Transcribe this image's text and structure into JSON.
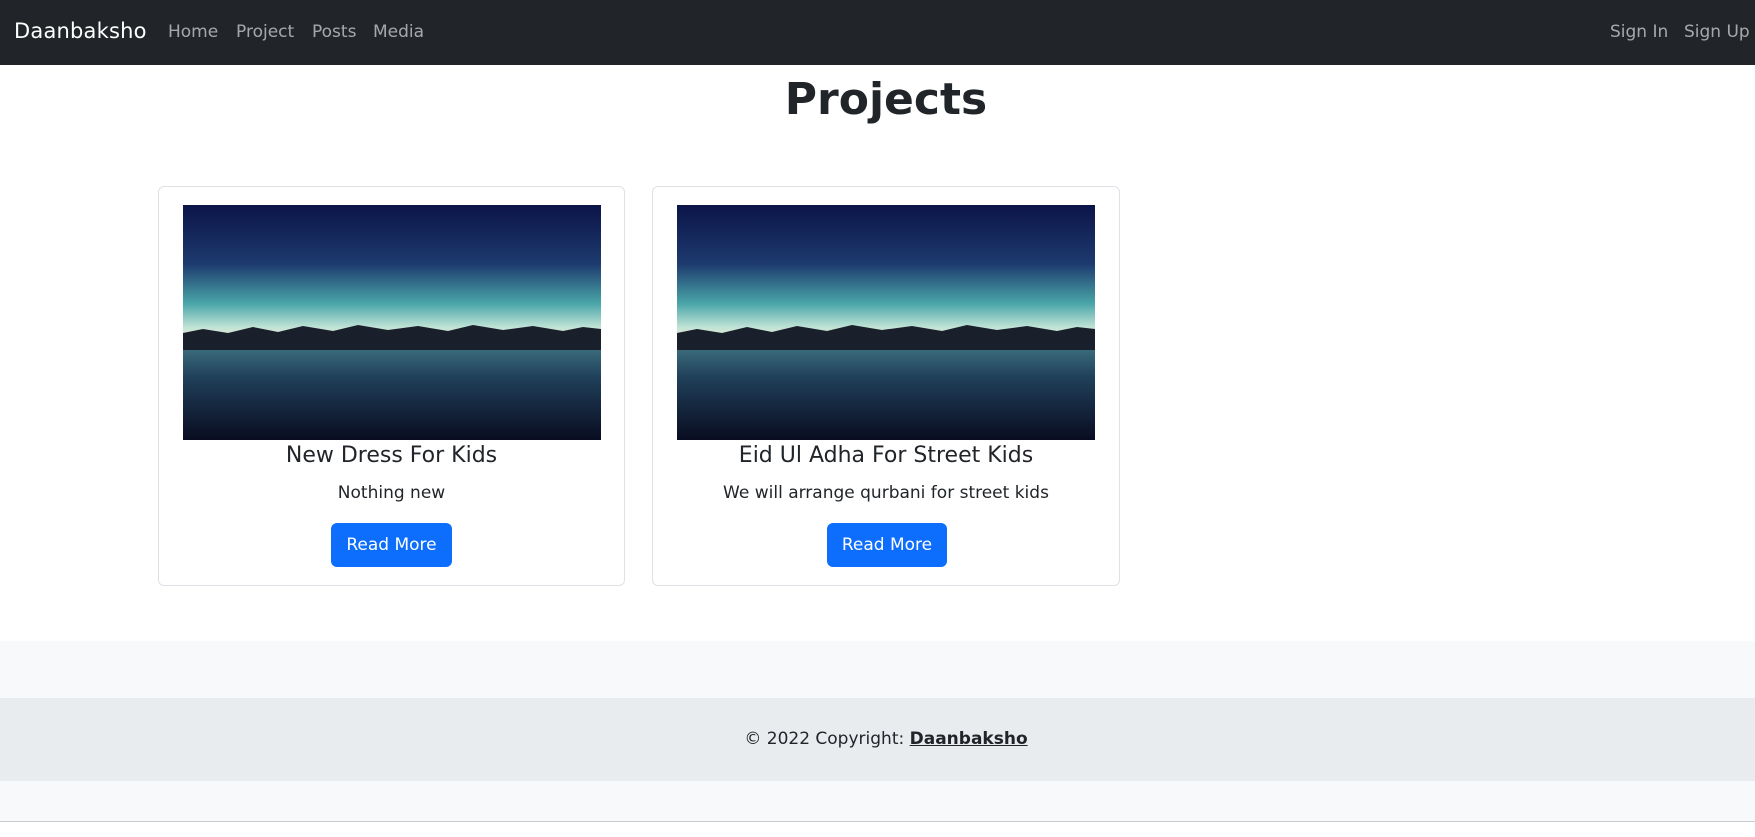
{
  "navbar": {
    "brand": "Daanbaksho",
    "links": [
      "Home",
      "Project",
      "Posts",
      "Media"
    ],
    "auth": [
      "Sign In",
      "Sign Up"
    ]
  },
  "page": {
    "title": "Projects"
  },
  "cards": [
    {
      "title": "New Dress For Kids",
      "text": "Nothing new",
      "button": "Read More"
    },
    {
      "title": "Eid Ul Adha For Street Kids",
      "text": "We will arrange qurbani for street kids",
      "button": "Read More"
    }
  ],
  "footer": {
    "copyright": "© 2022 Copyright: ",
    "brand": "Daanbaksho"
  },
  "colors": {
    "navbar": "#212529",
    "primary": "#0d6efd",
    "footer": "#e9ecef"
  }
}
